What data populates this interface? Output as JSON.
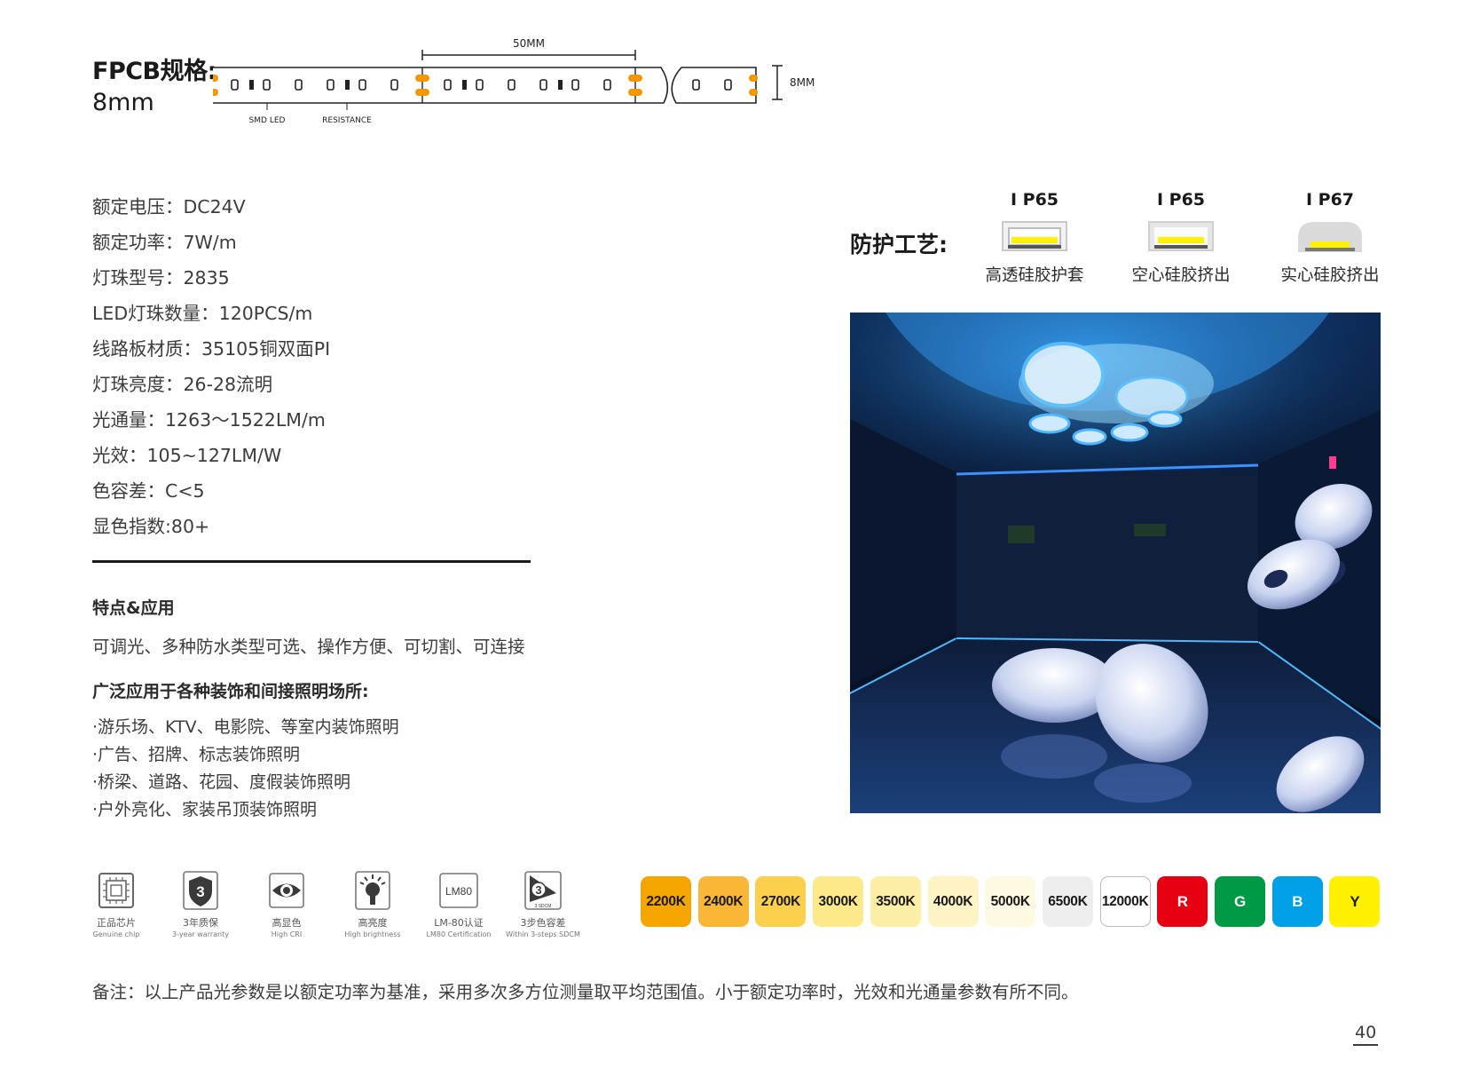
{
  "fpcb": {
    "title": "FPCB规格:",
    "width": "8mm",
    "dimension_top": "50MM",
    "dimension_side": "8MM",
    "label_led": "SMD LED",
    "label_resistance": "RESISTANCE"
  },
  "specs": [
    "额定电压：DC24V",
    "额定功率：7W/m",
    "灯珠型号：2835",
    "LED灯珠数量：120PCS/m",
    "线路板材质：35105铜双面PI",
    "灯珠亮度：26-28流明",
    "光通量：1263～1522LM/m",
    "光效：105~127LM/W",
    "色容差：C<5",
    "显色指数:80+"
  ],
  "features": {
    "heading": "特点&应用",
    "text": "可调光、多种防水类型可选、操作方便、可切割、可连接"
  },
  "applications": {
    "heading": "广泛应用于各种装饰和间接照明场所:",
    "items": [
      "·游乐场、KTV、电影院、等室内装饰照明",
      "·广告、招牌、标志装饰照明",
      "·桥梁、道路、花园、度假装饰照明",
      "·户外亮化、家装吊顶装饰照明"
    ]
  },
  "protection": {
    "label": "防护工艺:",
    "items": [
      {
        "ip": "I P65",
        "name": "高透硅胶护套"
      },
      {
        "ip": "I P65",
        "name": "空心硅胶挤出"
      },
      {
        "ip": "I P67",
        "name": "实心硅胶挤出"
      }
    ]
  },
  "feature_icons": [
    {
      "icon": "chip-icon",
      "zh": "正品芯片",
      "en": "Genuine chip"
    },
    {
      "icon": "shield-3-icon",
      "zh": "3年质保",
      "en": "3-year warranty",
      "glyph": "3"
    },
    {
      "icon": "eye-icon",
      "zh": "高显色",
      "en": "High CRI"
    },
    {
      "icon": "bulb-icon",
      "zh": "高亮度",
      "en": "High brightness"
    },
    {
      "icon": "lm80-icon",
      "zh": "LM-80认证",
      "en": "LM80 Certification",
      "glyph": "LM80"
    },
    {
      "icon": "sdcm-icon",
      "zh": "3步色容差",
      "en": "Within 3-steps SDCM",
      "glyph": "3",
      "sub": "3 SDCM"
    }
  ],
  "color_chips": [
    {
      "label": "2200K",
      "color": "#f5a500"
    },
    {
      "label": "2400K",
      "color": "#f9b637"
    },
    {
      "label": "2700K",
      "color": "#fccf4d"
    },
    {
      "label": "3000K",
      "color": "#fde989"
    },
    {
      "label": "3500K",
      "color": "#fdeea6"
    },
    {
      "label": "4000K",
      "color": "#fdf3c4"
    },
    {
      "label": "5000K",
      "color": "#fefae2"
    },
    {
      "label": "6500K",
      "color": "#eeeeee"
    },
    {
      "label": "12000K",
      "color": "#ffffff"
    },
    {
      "label": "R",
      "color": "#e60012"
    },
    {
      "label": "G",
      "color": "#009944"
    },
    {
      "label": "B",
      "color": "#00a0e9"
    },
    {
      "label": "Y",
      "color": "#fff100"
    }
  ],
  "note": "备注：以上产品光参数是以额定功率为基准，采用多次多方位测量取平均范围值。小于额定功率时，光效和光通量参数有所不同。",
  "page_number": "40"
}
